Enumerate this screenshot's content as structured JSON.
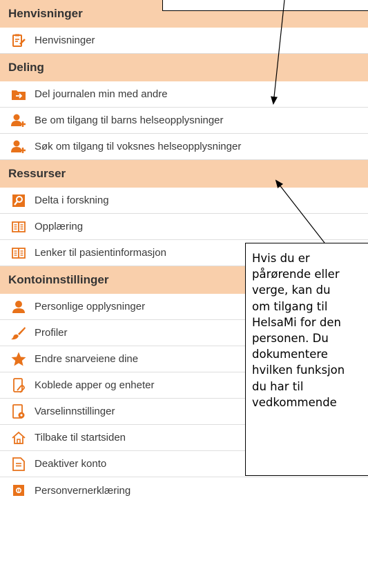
{
  "sections": [
    {
      "title": "Henvisninger",
      "items": [
        {
          "label": "Henvisninger",
          "icon": "referral-icon"
        }
      ]
    },
    {
      "title": "Deling",
      "items": [
        {
          "label": "Del journalen min med andre",
          "icon": "share-journal-icon"
        },
        {
          "label": "Be om tilgang til barns helseopplysninger",
          "icon": "add-person-icon"
        },
        {
          "label": "Søk om tilgang til voksnes helseopplysninger",
          "icon": "add-person-icon"
        }
      ]
    },
    {
      "title": "Ressurser",
      "items": [
        {
          "label": "Delta i forskning",
          "icon": "research-icon"
        },
        {
          "label": "Opplæring",
          "icon": "book-icon"
        },
        {
          "label": "Lenker til pasientinformasjon",
          "icon": "book-icon"
        }
      ]
    },
    {
      "title": "Kontoinnstillinger",
      "items": [
        {
          "label": "Personlige opplysninger",
          "icon": "person-icon"
        },
        {
          "label": "Profiler",
          "icon": "brush-icon"
        },
        {
          "label": "Endre snarveiene dine",
          "icon": "star-icon"
        },
        {
          "label": "Koblede apper og enheter",
          "icon": "linked-device-icon"
        },
        {
          "label": "Varselinnstillinger",
          "icon": "notification-settings-icon"
        },
        {
          "label": "Tilbake til startsiden",
          "icon": "home-icon"
        },
        {
          "label": "Deaktiver konto",
          "icon": "document-icon"
        },
        {
          "label": "Personvernerklæring",
          "icon": "privacy-icon"
        }
      ]
    }
  ],
  "callout": {
    "lines": [
      "Hvis du er",
      "pårørende eller",
      "verge, kan du",
      "om tilgang til",
      "HelsaMi for den",
      "personen. Du",
      "dokumentere",
      "hvilken funksjon",
      "du har til",
      "vedkommende"
    ]
  },
  "colors": {
    "section_bg": "#f9cfab",
    "icon_orange": "#e8721a"
  }
}
